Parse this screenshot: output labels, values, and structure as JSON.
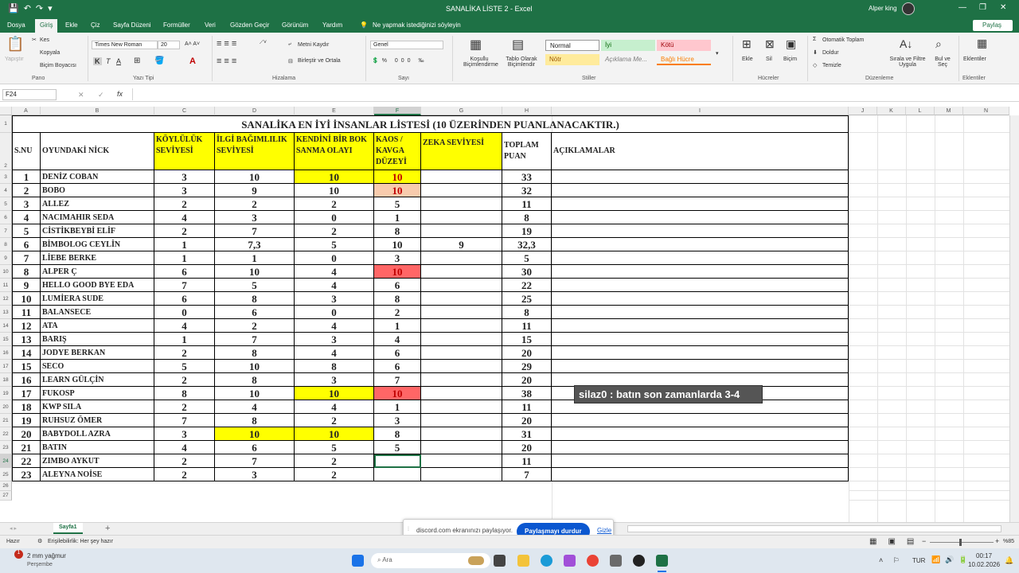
{
  "titlebar": {
    "title": "SANALİKA LİSTE 2  -  Excel",
    "user": "Alper king",
    "min": "—",
    "restore": "❐",
    "close": "✕"
  },
  "menu": {
    "items": [
      "Dosya",
      "Giriş",
      "Ekle",
      "Çiz",
      "Sayfa Düzeni",
      "Formüller",
      "Veri",
      "Gözden Geçir",
      "Görünüm",
      "Yardım"
    ],
    "tellme": "Ne yapmak istediğinizi söyleyin",
    "share": "Paylaş"
  },
  "ribbon": {
    "clipboard": {
      "paste": "Yapıştır",
      "cut": "Kes",
      "copy": "Kopyala",
      "painter": "Biçim Boyacısı",
      "label": "Pano"
    },
    "font": {
      "name": "Times New Roman",
      "size": "20",
      "label": "Yazı Tipi"
    },
    "align": {
      "wrap": "Metni Kaydır",
      "merge": "Birleştir ve Ortala",
      "label": "Hizalama"
    },
    "number": {
      "format": "Genel",
      "label": "Sayı"
    },
    "styles": {
      "cond": "Koşullu Biçimlendirme",
      "table": "Tablo Olarak Biçimlendir",
      "normal": "Normal",
      "iyi": "İyi",
      "kotu": "Kötü",
      "notr": "Nötr",
      "aciklama": "Açıklama Me...",
      "bagli": "Bağlı Hücre",
      "label": "Stiller"
    },
    "cells": {
      "insert": "Ekle",
      "delete": "Sil",
      "format": "Biçim",
      "label": "Hücreler"
    },
    "editing": {
      "autosum": "Otomatik Toplam",
      "fill": "Doldur",
      "clear": "Temizle",
      "sort": "Sırala ve Filtre Uygula",
      "find": "Bul ve Seç",
      "label": "Düzenleme"
    },
    "addins": {
      "btn": "Eklentiler",
      "label": "Eklentiler"
    }
  },
  "formula_bar": {
    "name_box": "F24",
    "fx": "fx",
    "content": ""
  },
  "columns": [
    "A",
    "B",
    "C",
    "D",
    "E",
    "F",
    "G",
    "H",
    "I",
    "J",
    "K",
    "L",
    "M",
    "N"
  ],
  "sheet": {
    "title": "SANALİKA EN İYİ İNSANLAR LİSTESİ  (10 ÜZERİNDEN PUANLANACAKTIR.)",
    "headers": [
      "S.NU",
      "OYUNDAKİ NİCK",
      "KÖYLÜLÜK SEVİYESİ",
      "İLGİ BAĞIMLILIK SEVİYESİ",
      "KENDİNİ BİR BOK SANMA OLAYI",
      "KAOS / KAVGA DÜZEYİ",
      "ZEKA SEVİYESİ",
      "TOPLAM PUAN",
      "AÇIKLAMALAR"
    ],
    "rows": [
      [
        "1",
        "DENİZ COBAN",
        "3",
        "10",
        "10",
        "10",
        "",
        "33"
      ],
      [
        "2",
        "BOBO",
        "3",
        "9",
        "10",
        "10",
        "",
        "32"
      ],
      [
        "3",
        "ALLEZ",
        "2",
        "2",
        "2",
        "5",
        "",
        "11"
      ],
      [
        "4",
        "NACIMAHIR SEDA",
        "4",
        "3",
        "0",
        "1",
        "",
        "8"
      ],
      [
        "5",
        "CİSTİKBEYBİ ELİF",
        "2",
        "7",
        "2",
        "8",
        "",
        "19"
      ],
      [
        "6",
        "BİMBOLOG CEYLİN",
        "1",
        "7,3",
        "5",
        "10",
        "9",
        "32,3"
      ],
      [
        "7",
        "LİEBE BERKE",
        "1",
        "1",
        "0",
        "3",
        "",
        "5"
      ],
      [
        "8",
        "ALPER Ç",
        "6",
        "10",
        "4",
        "10",
        "",
        "30"
      ],
      [
        "9",
        "HELLO GOOD BYE EDA",
        "7",
        "5",
        "4",
        "6",
        "",
        "22"
      ],
      [
        "10",
        "LUMİERA SUDE",
        "6",
        "8",
        "3",
        "8",
        "",
        "25"
      ],
      [
        "11",
        "BALANSECE",
        "0",
        "6",
        "0",
        "2",
        "",
        "8"
      ],
      [
        "12",
        "ATA",
        "4",
        "2",
        "4",
        "1",
        "",
        "11"
      ],
      [
        "13",
        "BARIŞ",
        "1",
        "7",
        "3",
        "4",
        "",
        "15"
      ],
      [
        "14",
        "JODYE BERKAN",
        "2",
        "8",
        "4",
        "6",
        "",
        "20"
      ],
      [
        "15",
        "SECO",
        "5",
        "10",
        "8",
        "6",
        "",
        "29"
      ],
      [
        "16",
        "LEARN GÜLÇİN",
        "2",
        "8",
        "3",
        "7",
        "",
        "20"
      ],
      [
        "17",
        "FUKOSP",
        "8",
        "10",
        "10",
        "10",
        "",
        "38"
      ],
      [
        "18",
        "KWP SILA",
        "2",
        "4",
        "4",
        "1",
        "",
        "11"
      ],
      [
        "19",
        "RUHSUZ ÖMER",
        "7",
        "8",
        "2",
        "3",
        "",
        "20"
      ],
      [
        "20",
        "BABYDOLL AZRA",
        "3",
        "10",
        "10",
        "8",
        "",
        "31"
      ],
      [
        "21",
        "BATIN",
        "4",
        "6",
        "5",
        "5",
        "",
        "20"
      ],
      [
        "22",
        "ZIMBO AYKUT",
        "2",
        "7",
        "2",
        "",
        "",
        "11"
      ],
      [
        "23",
        "ALEYNA NOİSE",
        "2",
        "3",
        "2",
        "",
        "",
        "7"
      ]
    ],
    "highlights": [
      {
        "row": 1,
        "col": 5,
        "color": "#ffff00"
      },
      {
        "row": 1,
        "col": 6,
        "color": "#ffff00"
      },
      {
        "row": 2,
        "col": 6,
        "color": "#f8cbad"
      },
      {
        "row": 8,
        "col": 6,
        "color": "#ff6666"
      },
      {
        "row": 17,
        "col": 5,
        "color": "#ffff00"
      },
      {
        "row": 17,
        "col": 6,
        "color": "#ff6666"
      },
      {
        "row": 20,
        "col": 4,
        "color": "#ffff00"
      },
      {
        "row": 20,
        "col": 5,
        "color": "#ffff00"
      }
    ]
  },
  "overlay": {
    "text": "silaz0 : batın son zamanlarda 3-4"
  },
  "sheet_tabs": {
    "tab": "Sayfa1",
    "add": "+"
  },
  "share_bar": {
    "text": "discord.com ekranınızı paylaşıyor.",
    "stop": "Paylaşmayı durdur",
    "hide": "Gizle"
  },
  "status": {
    "ready": "Hazır",
    "access": "Erişilebilirlik: Her şey hazır",
    "zoom": "%85"
  },
  "taskbar": {
    "weather": "2 mm yağmur",
    "day": "Perşembe",
    "search": "Ara",
    "lang": "TUR",
    "time": "00:17",
    "date": "10.02.2026"
  },
  "colors": {
    "excel_green": "#1e7145",
    "yellow": "#ffff00",
    "red_fill": "#ff6666",
    "salmon_fill": "#f8cbad",
    "red_text": "#c00000"
  }
}
